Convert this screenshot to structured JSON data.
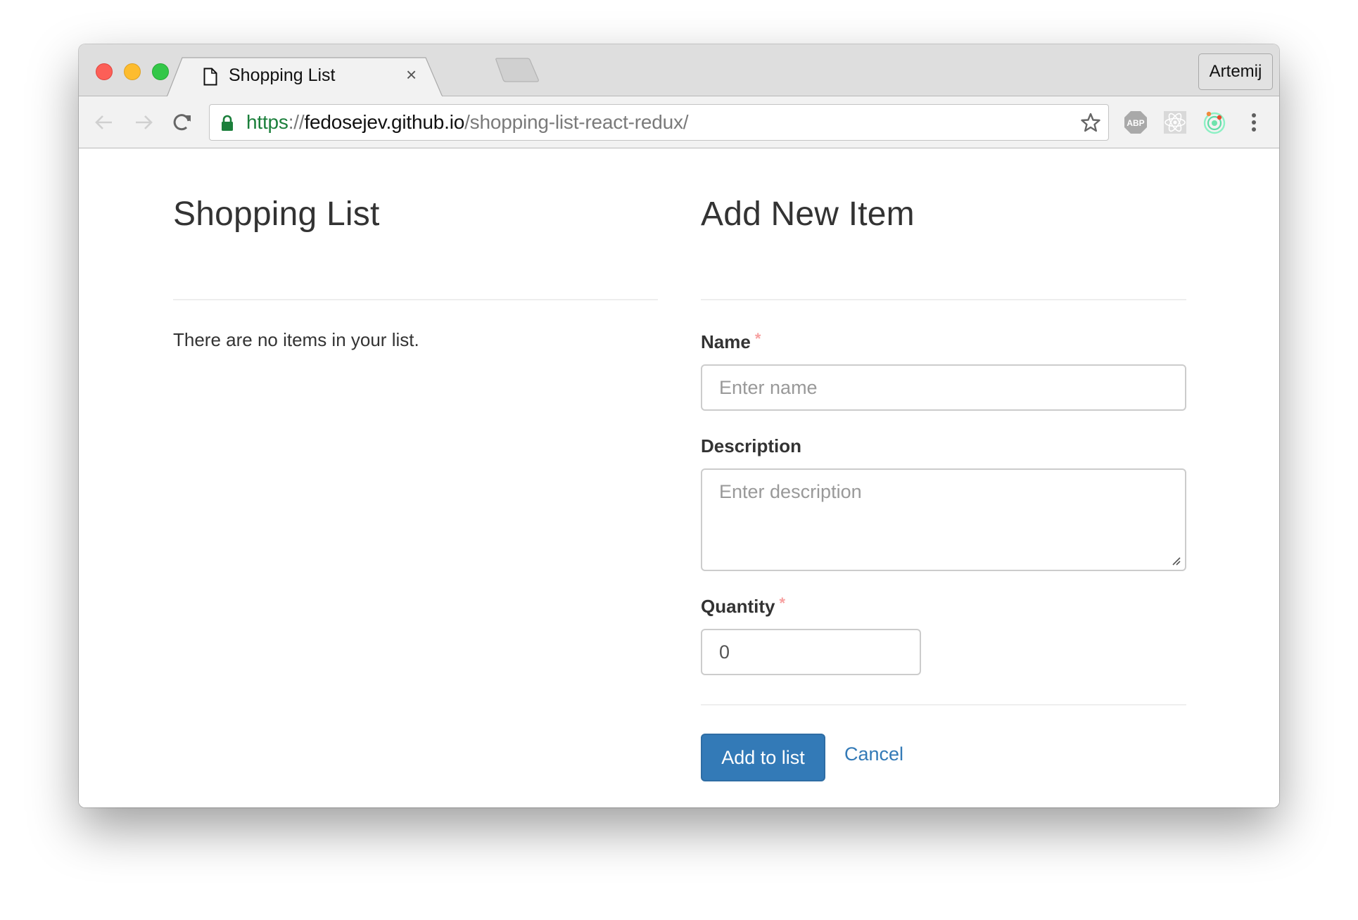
{
  "browser": {
    "tab": {
      "title": "Shopping List",
      "icon": "document-icon",
      "close_glyph": "×"
    },
    "profile_name": "Artemij",
    "url": {
      "scheme": "https",
      "separator": "://",
      "host": "fedosejev.github.io",
      "path": "/shopping-list-react-redux/"
    },
    "extensions": [
      "adblock-plus-icon",
      "react-devtools-icon",
      "orbit-extension-icon"
    ],
    "colors": {
      "secure_green": "#1b7f3b"
    }
  },
  "shopping_list": {
    "title": "Shopping List",
    "empty_message": "There are no items in your list."
  },
  "add_item_form": {
    "title": "Add New Item",
    "required_marker": "*",
    "name": {
      "label": "Name",
      "placeholder": "Enter name",
      "value": ""
    },
    "description": {
      "label": "Description",
      "placeholder": "Enter description",
      "value": ""
    },
    "quantity": {
      "label": "Quantity",
      "value": "0"
    },
    "submit_label": "Add to list",
    "cancel_label": "Cancel",
    "colors": {
      "primary": "#337ab7",
      "required": "#f7a0a0"
    }
  }
}
